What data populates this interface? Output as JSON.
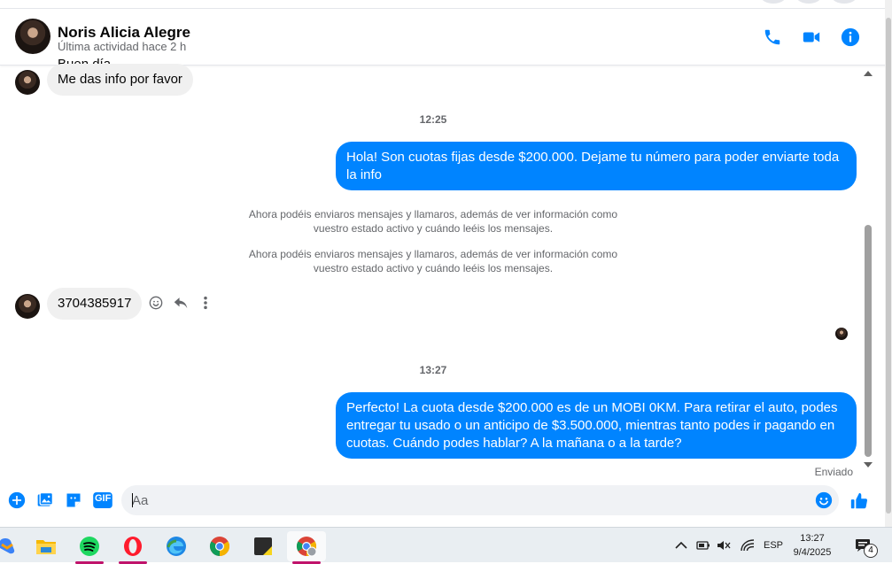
{
  "colors": {
    "accent": "#0084ff",
    "bubble_in": "#f0f0f0",
    "muted": "#65676b"
  },
  "header": {
    "name": "Noris Alicia Alegre",
    "status": "Última actividad hace 2 h",
    "icons": [
      "phone-icon",
      "video-camera-icon",
      "info-icon"
    ]
  },
  "messages": {
    "cut_text": "Buen día",
    "in_1": "Me das info por favor",
    "time_1": "12:25",
    "out_1_line1": "Hola! Son cuotas fijas desde $200.000. Dejame tu número para poder enviarte toda",
    "out_1_line2": "la info",
    "sys_1_line1": "Ahora podéis enviaros mensajes y llamaros, además de ver información como",
    "sys_1_line2": "vuestro estado activo y cuándo leéis los mensajes.",
    "sys_2_line1": "Ahora podéis enviaros mensajes y llamaros, además de ver información como",
    "sys_2_line2": "vuestro estado activo y cuándo leéis los mensajes.",
    "in_2": "3704385917",
    "time_2": "13:27",
    "out_2_line1": "Perfecto! La cuota desde $200.000 es de un MOBI 0KM. Para retirar el auto, podes",
    "out_2_line2": "entregar tu usado o un anticipo de $3.500.000, mientras tanto podes ir pagando en",
    "out_2_line3": "cuotas. Cuándo podes hablar? A la mañana o a la tarde?",
    "status": "Enviado"
  },
  "composer": {
    "placeholder": "Aa",
    "gif_label": "GIF",
    "icons": [
      "plus-icon",
      "image-icon",
      "sticker-icon",
      "gif-icon",
      "emoji-icon",
      "thumbs-up-icon"
    ]
  },
  "taskbar": {
    "apps": [
      "copilot-icon",
      "file-explorer-icon",
      "spotify-icon",
      "opera-icon",
      "edge-icon",
      "chrome-icon",
      "sticky-notes-icon",
      "chrome-profile-icon"
    ],
    "lang": "ESP",
    "time": "13:27",
    "date": "9/4/2025",
    "notif_count": "4"
  }
}
